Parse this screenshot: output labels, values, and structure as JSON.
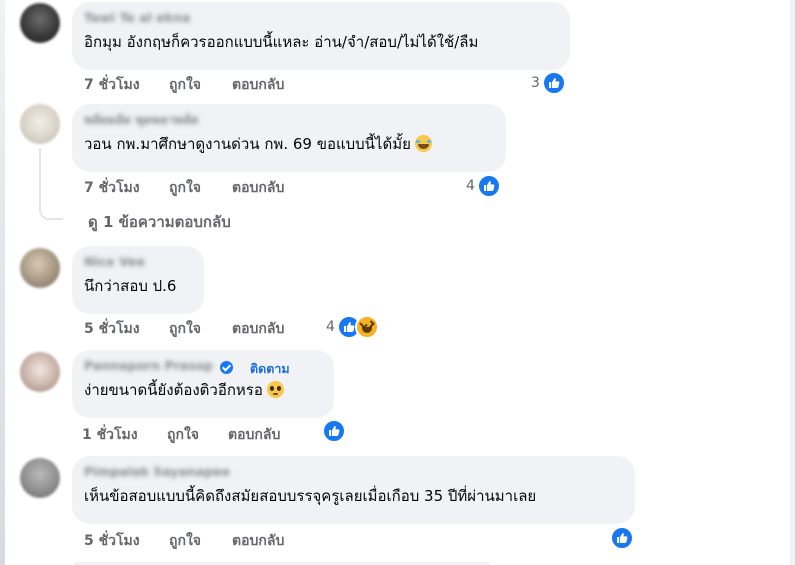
{
  "comments": [
    {
      "author": "Tawi Te al ekna",
      "text": "อิกมุม อังกฤษก็ควรออกแบบนี้แหละ อ่าน/จำ/สอบ/ไม่ได้ใช้/ลืม",
      "time": "7 ชั่วโมง",
      "like": "ถูกใจ",
      "reply": "ตอบกลับ",
      "reaction_count": "3",
      "reactions": [
        "like-icon"
      ]
    },
    {
      "author": "พลัดผลัด พุดพลาพลัด",
      "text": "วอน กพ.มาศึกษาดูงานด่วน กพ. 69 ขอแบบนี้ได้มั้ย",
      "emoji": "laughing-tears-emoji",
      "time": "7 ชั่วโมง",
      "like": "ถูกใจ",
      "reply": "ตอบกลับ",
      "reaction_count": "4",
      "reactions": [
        "like-icon"
      ]
    },
    {
      "author": "Nice Vee",
      "text": "นึกว่าสอบ ป.6",
      "time": "5 ชั่วโมง",
      "like": "ถูกใจ",
      "reply": "ตอบกลับ",
      "reaction_count": "4",
      "reactions": [
        "like-icon",
        "haha-icon"
      ]
    },
    {
      "author": "Pannaporn Prasop",
      "follow": "ติดตาม",
      "text": "ง่ายขนาดนี้ยังต้องติวอีกหรอ",
      "emoji": "pleading-face-emoji",
      "time": "1 ชั่วโมง",
      "like": "ถูกใจ",
      "reply": "ตอบกลับ",
      "reaction_count": "",
      "reactions": [
        "like-icon"
      ]
    },
    {
      "author": "Pimpalak Sayanapee",
      "text": "เห็นข้อสอบแบบนี้คิดถึงสมัยสอบบรรจุครูเลยเมื่อเกือบ 35 ปีที่ผ่านมาเลย",
      "time": "5 ชั่วโมง",
      "like": "ถูกใจ",
      "reply": "ตอบกลับ",
      "reaction_count": "",
      "reactions": [
        "like-icon"
      ]
    }
  ],
  "view_replies": "ดู 1 ข้อความตอบกลับ",
  "colors": {
    "bubble": "#f0f2f5",
    "meta_text": "#65676b",
    "like_blue": "#1877f2",
    "follow_blue": "#216fdb"
  }
}
